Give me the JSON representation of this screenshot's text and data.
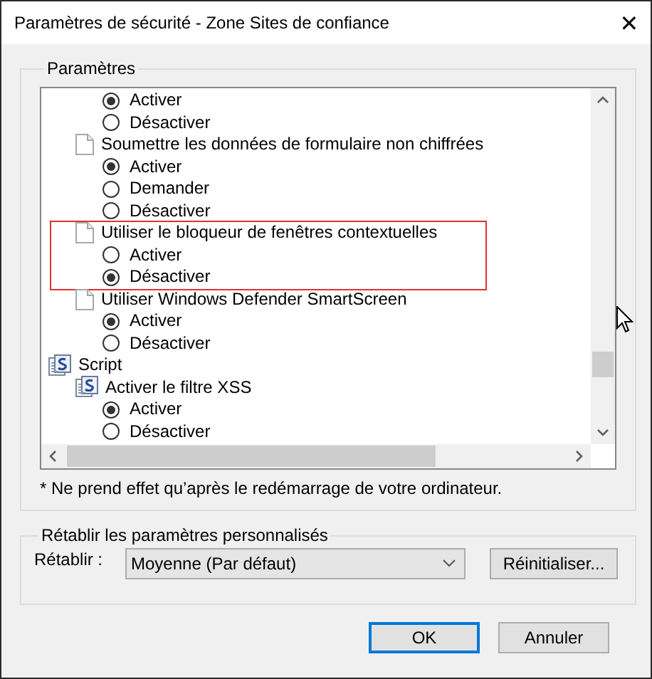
{
  "window": {
    "title": "Paramètres de sécurité - Zone Sites de confiance",
    "close": "✕"
  },
  "settings_group": {
    "title": "Paramètres",
    "tree": [
      {
        "kind": "group",
        "children": [
          {
            "kind": "group",
            "children": [
              {
                "kind": "option",
                "label": "Activer",
                "selected": true
              },
              {
                "kind": "option",
                "label": "Désactiver",
                "selected": false
              }
            ]
          },
          {
            "kind": "setting",
            "label": "Soumettre les données de formulaire non chiffrées",
            "highlighted": false,
            "children": [
              {
                "kind": "option",
                "label": "Activer",
                "selected": true
              },
              {
                "kind": "option",
                "label": "Demander",
                "selected": false
              },
              {
                "kind": "option",
                "label": "Désactiver",
                "selected": false
              }
            ]
          },
          {
            "kind": "setting",
            "label": "Utiliser le bloqueur de fenêtres contextuelles",
            "highlighted": true,
            "children": [
              {
                "kind": "option",
                "label": "Activer",
                "selected": false
              },
              {
                "kind": "option",
                "label": "Désactiver",
                "selected": true
              }
            ]
          },
          {
            "kind": "setting",
            "label": "Utiliser Windows Defender SmartScreen",
            "highlighted": false,
            "children": [
              {
                "kind": "option",
                "label": "Activer",
                "selected": true
              },
              {
                "kind": "option",
                "label": "Désactiver",
                "selected": false
              }
            ]
          }
        ]
      },
      {
        "kind": "category",
        "label": "Script",
        "children": [
          {
            "kind": "script-setting",
            "label": "Activer le filtre XSS",
            "highlighted": false,
            "children": [
              {
                "kind": "option",
                "label": "Activer",
                "selected": true
              },
              {
                "kind": "option",
                "label": "Désactiver",
                "selected": false
              }
            ]
          }
        ]
      }
    ],
    "footnote": "* Ne prend effet qu’après le redémarrage de votre ordinateur."
  },
  "reset_group": {
    "title": "Rétablir les paramètres personnalisés",
    "label": "Rétablir :",
    "dropdown_value": "Moyenne (Par défaut)",
    "reset_button": "Réinitialiser..."
  },
  "buttons": [
    {
      "label": "OK",
      "default": true
    },
    {
      "label": "Annuler",
      "default": false
    }
  ]
}
